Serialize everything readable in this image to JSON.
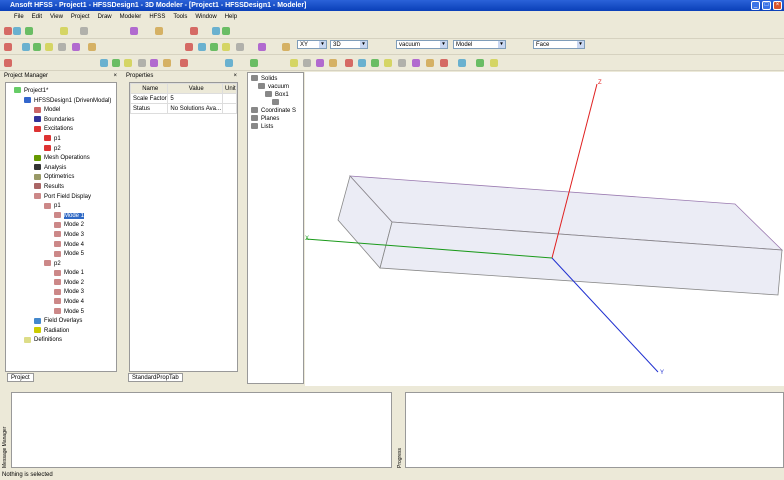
{
  "window": {
    "title": "Ansoft HFSS - Project1 - HFSSDesign1 - 3D Modeler - [Project1 - HFSSDesign1 - Modeler]"
  },
  "menu": [
    "File",
    "Edit",
    "View",
    "Project",
    "Draw",
    "Modeler",
    "HFSS",
    "Tools",
    "Window",
    "Help"
  ],
  "toolbar": {
    "plane": "XY",
    "view": "3D",
    "material": "vacuum",
    "mode": "Model",
    "select": "Face"
  },
  "project_manager": {
    "title": "Project Manager",
    "tab": "Project",
    "tree": [
      {
        "label": "Project1*",
        "level": 0,
        "color": "#6c6"
      },
      {
        "label": "HFSSDesign1 (DrivenModal)",
        "level": 1,
        "color": "#36c"
      },
      {
        "label": "Model",
        "level": 2,
        "color": "#c66"
      },
      {
        "label": "Boundaries",
        "level": 2,
        "color": "#339"
      },
      {
        "label": "Excitations",
        "level": 2,
        "color": "#d33"
      },
      {
        "label": "p1",
        "level": 3,
        "color": "#d33"
      },
      {
        "label": "p2",
        "level": 3,
        "color": "#d33"
      },
      {
        "label": "Mesh Operations",
        "level": 2,
        "color": "#690"
      },
      {
        "label": "Analysis",
        "level": 2,
        "color": "#333"
      },
      {
        "label": "Optimetrics",
        "level": 2,
        "color": "#996"
      },
      {
        "label": "Results",
        "level": 2,
        "color": "#a66"
      },
      {
        "label": "Port Field Display",
        "level": 2,
        "color": "#c88"
      },
      {
        "label": "p1",
        "level": 3,
        "color": "#c88"
      },
      {
        "label": "Mode 1",
        "level": 4,
        "color": "#c88",
        "selected": true
      },
      {
        "label": "Mode 2",
        "level": 4,
        "color": "#c88"
      },
      {
        "label": "Mode 3",
        "level": 4,
        "color": "#c88"
      },
      {
        "label": "Mode 4",
        "level": 4,
        "color": "#c88"
      },
      {
        "label": "Mode 5",
        "level": 4,
        "color": "#c88"
      },
      {
        "label": "p2",
        "level": 3,
        "color": "#c88"
      },
      {
        "label": "Mode 1",
        "level": 4,
        "color": "#c88"
      },
      {
        "label": "Mode 2",
        "level": 4,
        "color": "#c88"
      },
      {
        "label": "Mode 3",
        "level": 4,
        "color": "#c88"
      },
      {
        "label": "Mode 4",
        "level": 4,
        "color": "#c88"
      },
      {
        "label": "Mode 5",
        "level": 4,
        "color": "#c88"
      },
      {
        "label": "Field Overlays",
        "level": 2,
        "color": "#48c"
      },
      {
        "label": "Radiation",
        "level": 2,
        "color": "#cc0"
      },
      {
        "label": "Definitions",
        "level": 1,
        "color": "#dd8"
      }
    ]
  },
  "properties": {
    "title": "Properties",
    "tab": "StandardPropTab",
    "headers": [
      "Name",
      "Value",
      "Unit"
    ],
    "rows": [
      [
        "Scale Factor",
        "5",
        ""
      ],
      [
        "Status",
        "No Solutions Ava...",
        ""
      ]
    ]
  },
  "model_tree": [
    {
      "label": "Solids",
      "level": 0
    },
    {
      "label": "vacuum",
      "level": 1
    },
    {
      "label": "Box1",
      "level": 2
    },
    {
      "label": "",
      "level": 3
    },
    {
      "label": "Coordinate S",
      "level": 0
    },
    {
      "label": "Planes",
      "level": 0
    },
    {
      "label": "Lists",
      "level": 0
    }
  ],
  "viewport": {
    "axes": {
      "x": "X",
      "y": "Y",
      "z": "Z"
    },
    "colors": {
      "x": "#1a9a1a",
      "y": "#2030d0",
      "z": "#e02020",
      "box_edge": "#9a7ab0"
    }
  },
  "bottom": {
    "message_manager": "Message Manager",
    "progress": "Progress"
  },
  "status": "Nothing is selected"
}
